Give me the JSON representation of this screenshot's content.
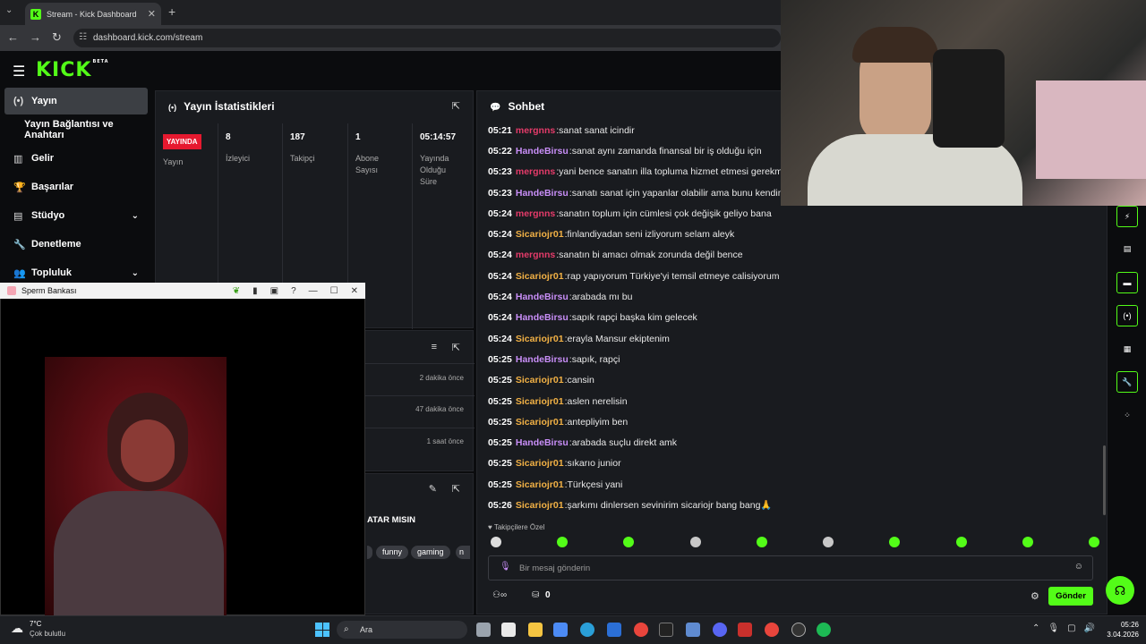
{
  "browser": {
    "tab_title": "Stream - Kick Dashboard",
    "url": "dashboard.kick.com/stream"
  },
  "brand": {
    "logo": "KICK",
    "beta": "BETA",
    "accent": "#53fc18"
  },
  "sidebar": {
    "items": [
      {
        "label": "Yayın",
        "icon": "broadcast-icon",
        "active": true
      },
      {
        "label": "Yayın Bağlantısı ve Anahtarı"
      },
      {
        "label": "Gelir",
        "icon": "chart-icon"
      },
      {
        "label": "Başarılar",
        "icon": "trophy-icon"
      },
      {
        "label": "Stüdyo",
        "icon": "studio-icon"
      },
      {
        "label": "Denetleme",
        "icon": "wrench-icon"
      },
      {
        "label": "Topluluk",
        "icon": "community-icon"
      }
    ]
  },
  "stats": {
    "title": "Yayın İstatistikleri",
    "live_badge": "YAYINDA",
    "cols": [
      {
        "value": "",
        "label": "Yayın"
      },
      {
        "value": "8",
        "label": "İzleyici"
      },
      {
        "value": "187",
        "label": "Takipçi"
      },
      {
        "value": "1",
        "label": "Abone Sayısı"
      },
      {
        "value": "05:14:57",
        "label": "Yayında Olduğu Süre"
      }
    ]
  },
  "activity": {
    "times": [
      "2 dakika önce",
      "47 dakika önce",
      "1 saat önce"
    ]
  },
  "stream_info": {
    "title_fragment": "ATAR MISIN",
    "tags": [
      "funny",
      "gaming",
      "n"
    ]
  },
  "chat": {
    "title": "Sohbet",
    "messages": [
      {
        "time": "05:21",
        "user": "mergnns",
        "color": "#e53b6a",
        "text": "sanat sanat icindir"
      },
      {
        "time": "05:22",
        "user": "HandeBirsu",
        "color": "#c88ef7",
        "text": "sanat aynı zamanda finansal bir iş olduğu için"
      },
      {
        "time": "05:23",
        "user": "mergnns",
        "color": "#e53b6a",
        "text": "yani bence sanatın illa topluma hizmet etmesi gerekmiyor"
      },
      {
        "time": "05:23",
        "user": "HandeBirsu",
        "color": "#c88ef7",
        "text": "sanatı sanat için yapanlar olabilir ama bunu kendine"
      },
      {
        "time": "05:24",
        "user": "mergnns",
        "color": "#e53b6a",
        "text": "sanatın toplum için cümlesi çok değişik geliyo bana"
      },
      {
        "time": "05:24",
        "user": "Sicariojr01",
        "color": "#f2b145",
        "text": "finlandiyadan seni izliyorum selam aleyk"
      },
      {
        "time": "05:24",
        "user": "mergnns",
        "color": "#e53b6a",
        "text": "sanatın bi amacı olmak zorunda değil bence"
      },
      {
        "time": "05:24",
        "user": "Sicariojr01",
        "color": "#f2b145",
        "text": "rap yapıyorum Türkiye'yi temsil etmeye calisiyorum"
      },
      {
        "time": "05:24",
        "user": "HandeBirsu",
        "color": "#c88ef7",
        "text": "arabada mı bu"
      },
      {
        "time": "05:24",
        "user": "HandeBirsu",
        "color": "#c88ef7",
        "text": "sapık rapçi başka kim gelecek"
      },
      {
        "time": "05:24",
        "user": "Sicariojr01",
        "color": "#f2b145",
        "text": "erayla Mansur ekiptenim"
      },
      {
        "time": "05:25",
        "user": "HandeBirsu",
        "color": "#c88ef7",
        "text": "sapık, rapçi"
      },
      {
        "time": "05:25",
        "user": "Sicariojr01",
        "color": "#f2b145",
        "text": "cansin"
      },
      {
        "time": "05:25",
        "user": "Sicariojr01",
        "color": "#f2b145",
        "text": "aslen nerelisin"
      },
      {
        "time": "05:25",
        "user": "Sicariojr01",
        "color": "#f2b145",
        "text": "antepliyim ben"
      },
      {
        "time": "05:25",
        "user": "HandeBirsu",
        "color": "#c88ef7",
        "text": "arabada suçlu direkt amk"
      },
      {
        "time": "05:25",
        "user": "Sicariojr01",
        "color": "#f2b145",
        "text": "sıkarıo junior"
      },
      {
        "time": "05:25",
        "user": "Sicariojr01",
        "color": "#f2b145",
        "text": "Türkçesi yani"
      },
      {
        "time": "05:26",
        "user": "Sicariojr01",
        "color": "#f2b145",
        "text": "şarkımı dinlersen sevinirim sicariojr bang bang🙏"
      }
    ],
    "followers_only": "Takipçilere Özel",
    "input_placeholder": "Bir mesaj gönderin",
    "points": "0",
    "send_label": "Gönder"
  },
  "float_window": {
    "title": "Sperm Bankası"
  },
  "taskbar": {
    "temp": "7°C",
    "weather": "Çok bulutlu",
    "search": "Ara",
    "time": "05:26",
    "date": "3.04.2026"
  }
}
